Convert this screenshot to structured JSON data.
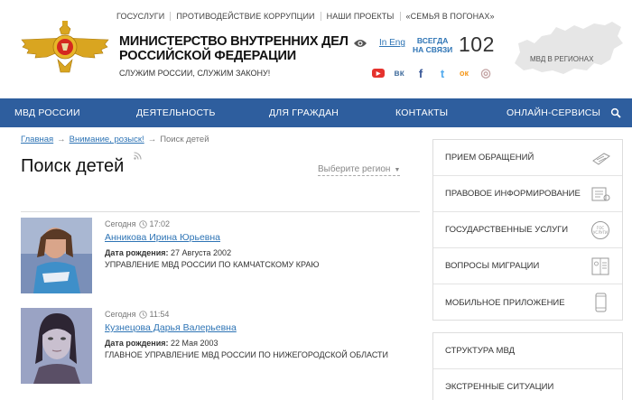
{
  "top_links": [
    "ГОСУСЛУГИ",
    "ПРОТИВОДЕЙСТВИЕ КОРРУПЦИИ",
    "НАШИ ПРОЕКТЫ",
    "«СЕМЬЯ В ПОГОНАХ»"
  ],
  "header": {
    "title_line1": "МИНИСТЕРСТВО ВНУТРЕННИХ ДЕЛ",
    "title_line2": "РОССИЙСКОЙ ФЕДЕРАЦИИ",
    "slogan": "СЛУЖИМ РОССИИ, СЛУЖИМ ЗАКОНУ!",
    "lang_link": "In Eng",
    "always_line1": "ВСЕГДА",
    "always_line2": "НА СВЯЗИ",
    "phone": "102",
    "map_label": "МВД В РЕГИОНАХ"
  },
  "socials": [
    {
      "icon": "youtube-icon",
      "glyph": "▶",
      "color": "#e5322d"
    },
    {
      "icon": "vk-icon",
      "glyph": "вк",
      "color": "#4c75a3"
    },
    {
      "icon": "facebook-icon",
      "glyph": "f",
      "color": "#3b5998"
    },
    {
      "icon": "twitter-icon",
      "glyph": "t",
      "color": "#55acee"
    },
    {
      "icon": "odnoklassniki-icon",
      "glyph": "ок",
      "color": "#f59a1f"
    },
    {
      "icon": "instagram-icon",
      "glyph": "◎",
      "color": "#c4a4a4"
    }
  ],
  "nav": [
    "МВД РОССИИ",
    "ДЕЯТЕЛЬНОСТЬ",
    "ДЛЯ ГРАЖДАН",
    "КОНТАКТЫ",
    "ОНЛАЙН-СЕРВИСЫ"
  ],
  "breadcrumb": {
    "home": "Главная",
    "section": "Внимание, розыск!",
    "current": "Поиск детей"
  },
  "page_title": "Поиск детей",
  "region_select": "Выберите регион",
  "results": [
    {
      "day": "Сегодня",
      "time": "17:02",
      "name": "Анникова Ирина Юрьевна",
      "dob_label": "Дата рождения:",
      "dob": "27 Августа 2002",
      "dept": "УПРАВЛЕНИЕ МВД РОССИИ ПО КАМЧАТСКОМУ КРАЮ"
    },
    {
      "day": "Сегодня",
      "time": "11:54",
      "name": "Кузнецова Дарья Валерьевна",
      "dob_label": "Дата рождения:",
      "dob": "22 Мая 2003",
      "dept": "ГЛАВНОЕ УПРАВЛЕНИЕ МВД РОССИИ ПО НИЖЕГОРОДСКОЙ ОБЛАСТИ"
    }
  ],
  "sidebar": [
    {
      "label": "ПРИЕМ ОБРАЩЕНИЙ",
      "icon": "form-icon"
    },
    {
      "label": "ПРАВОВОЕ ИНФОРМИРОВАНИЕ",
      "icon": "document-icon"
    },
    {
      "label": "ГОСУДАРСТВЕННЫЕ УСЛУГИ",
      "icon": "gosuslugi-icon"
    },
    {
      "label": "ВОПРОСЫ МИГРАЦИИ",
      "icon": "passport-icon"
    },
    {
      "label": "МОБИЛЬНОЕ ПРИЛОЖЕНИЕ",
      "icon": "phone-icon"
    }
  ],
  "sidebar2": [
    "СТРУКТУРА МВД",
    "ЭКСТРЕННЫЕ СИТУАЦИИ"
  ],
  "colors": {
    "nav_bg": "#2e5e9e",
    "link": "#2e74b5"
  }
}
